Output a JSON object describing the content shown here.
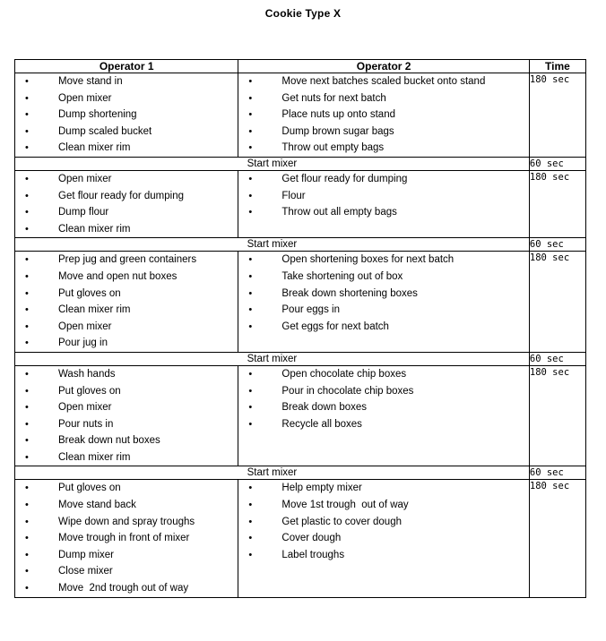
{
  "document": {
    "title": "Cookie Type X"
  },
  "table": {
    "headers": {
      "operator1": "Operator 1",
      "operator2": "Operator 2",
      "time": "Time"
    },
    "start_mixer_label": "Start mixer",
    "start_mixer_time": "60 sec",
    "sections": [
      {
        "time": "180 sec",
        "operator1": [
          "Move stand in",
          "Open mixer",
          "Dump shortening",
          "Dump scaled bucket",
          "Clean mixer rim"
        ],
        "operator2": [
          "Move next batches scaled bucket onto stand",
          "Get nuts for next batch",
          "Place nuts up onto stand",
          "Dump brown sugar bags",
          "Throw out empty bags"
        ]
      },
      {
        "time": "180 sec",
        "operator1": [
          "Open mixer",
          "Get flour ready for dumping",
          "Dump flour",
          "Clean mixer rim"
        ],
        "operator2": [
          "Get flour ready for dumping",
          "Flour",
          "Throw out all empty bags"
        ]
      },
      {
        "time": "180 sec",
        "operator1": [
          "Prep jug and green containers",
          "Move and open nut boxes",
          "Put gloves on",
          "Clean mixer rim",
          "Open mixer",
          "Pour jug in"
        ],
        "operator2": [
          "Open shortening boxes for next batch",
          "Take shortening out of box",
          "Break down shortening boxes",
          "Pour eggs in",
          "Get eggs for next batch"
        ]
      },
      {
        "time": "180 sec",
        "operator1": [
          "Wash hands",
          "Put gloves on",
          "Open mixer",
          "Pour nuts in",
          "Break down nut boxes",
          "Clean mixer rim"
        ],
        "operator2": [
          "Open chocolate chip boxes",
          "Pour in chocolate chip boxes",
          "Break down boxes",
          "Recycle all boxes"
        ]
      },
      {
        "time": "180 sec",
        "operator1": [
          "Put gloves on",
          "Move stand back",
          "Wipe down and spray troughs",
          "Move trough in front of mixer",
          "Dump mixer",
          "Close mixer",
          "Move  2nd trough out of way"
        ],
        "operator2": [
          "Help empty mixer",
          "Move 1st trough  out of way",
          "Get plastic to cover dough",
          "Cover dough",
          "Label troughs"
        ]
      }
    ]
  },
  "icons": {
    "bullet": "•"
  }
}
